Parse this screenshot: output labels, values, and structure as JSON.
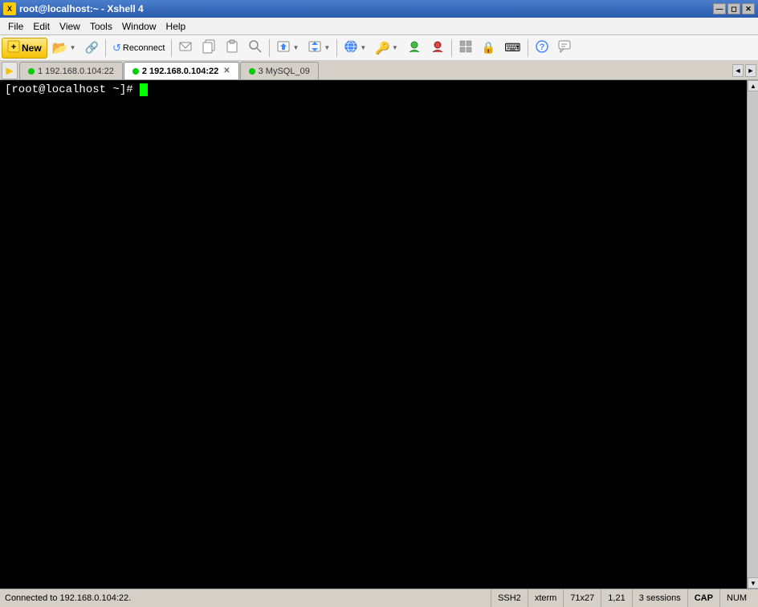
{
  "titleBar": {
    "title": "root@localhost:~ - Xshell 4",
    "icon": "X",
    "buttons": {
      "minimize": "—",
      "restore": "◻",
      "close": "✕"
    }
  },
  "menuBar": {
    "items": [
      "File",
      "Edit",
      "View",
      "Tools",
      "Window",
      "Help"
    ]
  },
  "toolbar": {
    "newButton": "New",
    "buttons": [
      {
        "name": "open-folder",
        "icon": "📂",
        "hasDropdown": true
      },
      {
        "name": "properties",
        "icon": "🔗"
      },
      {
        "name": "reconnect",
        "icon": "🔄",
        "label": "Reconnect"
      },
      {
        "name": "compose",
        "icon": "✉"
      },
      {
        "name": "copy",
        "icon": "⎘"
      },
      {
        "name": "paste",
        "icon": "📋"
      },
      {
        "name": "find",
        "icon": "🔍"
      },
      {
        "name": "transfer",
        "icon": "⇄",
        "hasDropdown": true
      },
      {
        "name": "sftp",
        "icon": "⇅",
        "hasDropdown": true
      },
      {
        "name": "tunneling",
        "icon": "🌐",
        "hasDropdown": true
      },
      {
        "name": "key",
        "icon": "🔑",
        "hasDropdown": true
      },
      {
        "name": "agent",
        "icon": "🐢"
      },
      {
        "name": "ftp",
        "icon": "🐢"
      },
      {
        "name": "security",
        "icon": "🔒"
      },
      {
        "name": "keyboard",
        "icon": "⌨"
      },
      {
        "name": "help",
        "icon": "❓"
      },
      {
        "name": "chat",
        "icon": "💬"
      }
    ]
  },
  "tabs": [
    {
      "id": 1,
      "label": "1 192.168.0.104:22",
      "active": false,
      "connected": true,
      "closeable": false
    },
    {
      "id": 2,
      "label": "2 192.168.0.104:22",
      "active": true,
      "connected": true,
      "closeable": true
    },
    {
      "id": 3,
      "label": "3 MySQL_09",
      "active": false,
      "connected": true,
      "closeable": false
    }
  ],
  "terminal": {
    "prompt": "[root@localhost ~]# ",
    "cursor": true
  },
  "statusBar": {
    "connected": "Connected to 192.168.0.104:22.",
    "protocol": "SSH2",
    "term": "xterm",
    "dimensions": "71x27",
    "position": "1,21",
    "sessions": "3 sessions",
    "cap": "CAP",
    "num": "NUM"
  }
}
